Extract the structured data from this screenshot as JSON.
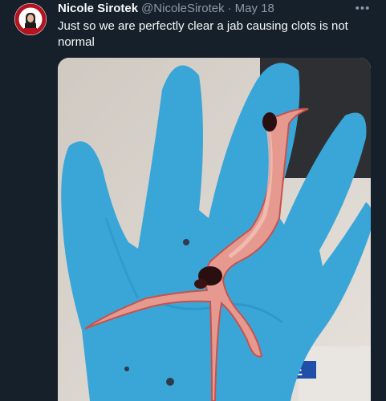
{
  "tweet": {
    "author_name": "Nicole Sirotek",
    "handle": "@NicoleSirotek",
    "separator": "·",
    "date": "May 18",
    "text": "Just so we are perfectly clear a jab causing clots is not normal",
    "more_icon": "more-horizontal-icon"
  },
  "media": {
    "label_fragment": "IE"
  },
  "colors": {
    "background": "#15202b",
    "primary_text": "#f7f9f9",
    "secondary_text": "#8b98a5",
    "glove": "#3aa6d8",
    "clot": "#e69a8f"
  }
}
